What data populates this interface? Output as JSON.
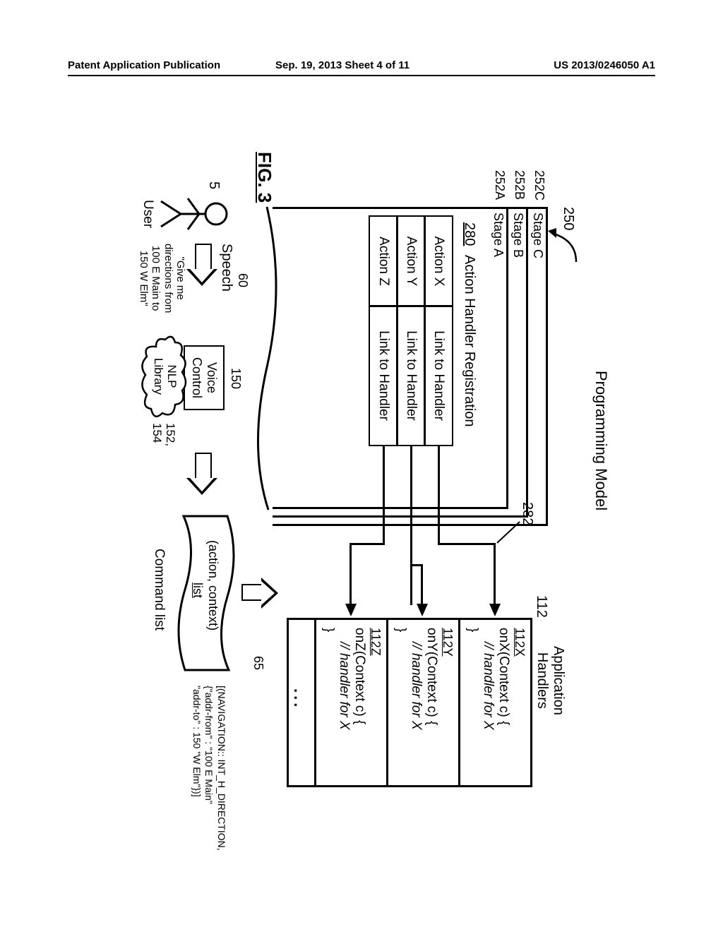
{
  "header": {
    "left": "Patent Application Publication",
    "center": "Sep. 19, 2013  Sheet 4 of 11",
    "right": "US 2013/0246050 A1"
  },
  "figure_label": "FIG. 3",
  "title": "Programming Model",
  "ref_top": "250",
  "stages": [
    {
      "ref": "252C",
      "label": "Stage C"
    },
    {
      "ref": "252B",
      "label": "Stage B"
    },
    {
      "ref": "252A",
      "label": "Stage A"
    }
  ],
  "registration": {
    "ref": "280",
    "label": "Action Handler Registration",
    "arrow_ref": "282",
    "rows": [
      {
        "action": "Action X",
        "link": "Link to Handler"
      },
      {
        "action": "Action Y",
        "link": "Link to Handler"
      },
      {
        "action": "Action Z",
        "link": "Link to Handler"
      }
    ]
  },
  "handlers": {
    "ref": "112",
    "label": "Application\nHandlers",
    "items": [
      {
        "ref": "112X",
        "sig": "onX(Context c) {",
        "body": "// handler for X",
        "close": "}"
      },
      {
        "ref": "112Y",
        "sig": "onY(Context c) {",
        "body": "// handler for X",
        "close": "}"
      },
      {
        "ref": "112Z",
        "sig": "onZ(Context c) {",
        "body": "// handler for X",
        "close": "}"
      }
    ],
    "more": "..."
  },
  "user": {
    "ref": "5",
    "label": "User"
  },
  "speech": {
    "ref": "60",
    "label": "Speech",
    "quote": "\"Give me\ndirections from\n100 E Main to\n150 W Elm\""
  },
  "voice_control": {
    "ref": "150",
    "label": "Voice\nControl"
  },
  "nlp": {
    "ref": "152,\n154",
    "label": "NLP\nLibrary"
  },
  "command_list": {
    "ref": "65",
    "banner_top": "(action, context)",
    "banner_bottom": "list",
    "label": "Command list",
    "example": "[(NAVIGATION:: INT_H_DIRECTION,\n{\"addr-from\" : \"100 E Main\"\n\"addr-to\" : 150 \"W Elm\"})]"
  }
}
